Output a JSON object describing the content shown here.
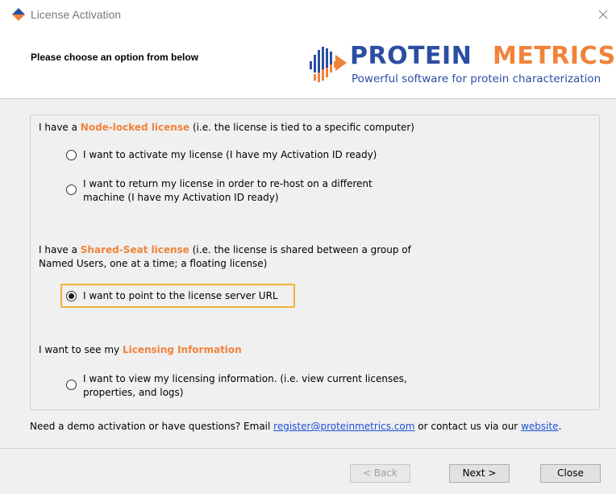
{
  "window": {
    "title": "License Activation",
    "close_icon": "close-icon",
    "app_icon": "protein-metrics-logo-icon"
  },
  "header": {
    "prompt": "Please choose an option from below",
    "logo_word1": "PROTEIN",
    "logo_word2": "METRICS",
    "tagline": "Powerful software for protein characterization",
    "brand_blue": "#2b4ea3",
    "brand_orange": "#f0833a"
  },
  "node_locked": {
    "prefix": "I have a ",
    "highlight": "Node-locked license",
    "suffix": " (i.e. the license is tied to a specific computer)",
    "options": [
      {
        "label": "I want to activate my license (I have my Activation ID ready)",
        "checked": false
      },
      {
        "label_line1": "I want to return my license in order to re-host on a different",
        "label_line2": "machine (I have my Activation ID ready)",
        "checked": false
      }
    ]
  },
  "shared_seat": {
    "prefix": "I have a ",
    "highlight": "Shared-Seat license",
    "suffix": " (i.e. the license is shared between a group of",
    "line2": "Named Users, one at a time; a floating license)",
    "options": [
      {
        "label": "I want to point to the license server URL",
        "checked": true
      }
    ]
  },
  "licensing_info": {
    "prefix": "I want to see my ",
    "highlight": "Licensing Information",
    "options": [
      {
        "label_line1": "I want to view my licensing information. (i.e. view current licenses,",
        "label_line2": "properties, and logs)",
        "checked": false
      }
    ]
  },
  "footer": {
    "text_before": "Need a demo activation or have questions? Email ",
    "email_link": "register@proteinmetrics.com",
    "text_middle": " or contact us via our ",
    "website_link": "website",
    "text_after": "."
  },
  "buttons": {
    "back": "< Back",
    "next": "Next >",
    "close": "Close",
    "back_enabled": false
  },
  "accent": {
    "selection_frame": "#f2b233",
    "link": "#1a4fd6"
  }
}
